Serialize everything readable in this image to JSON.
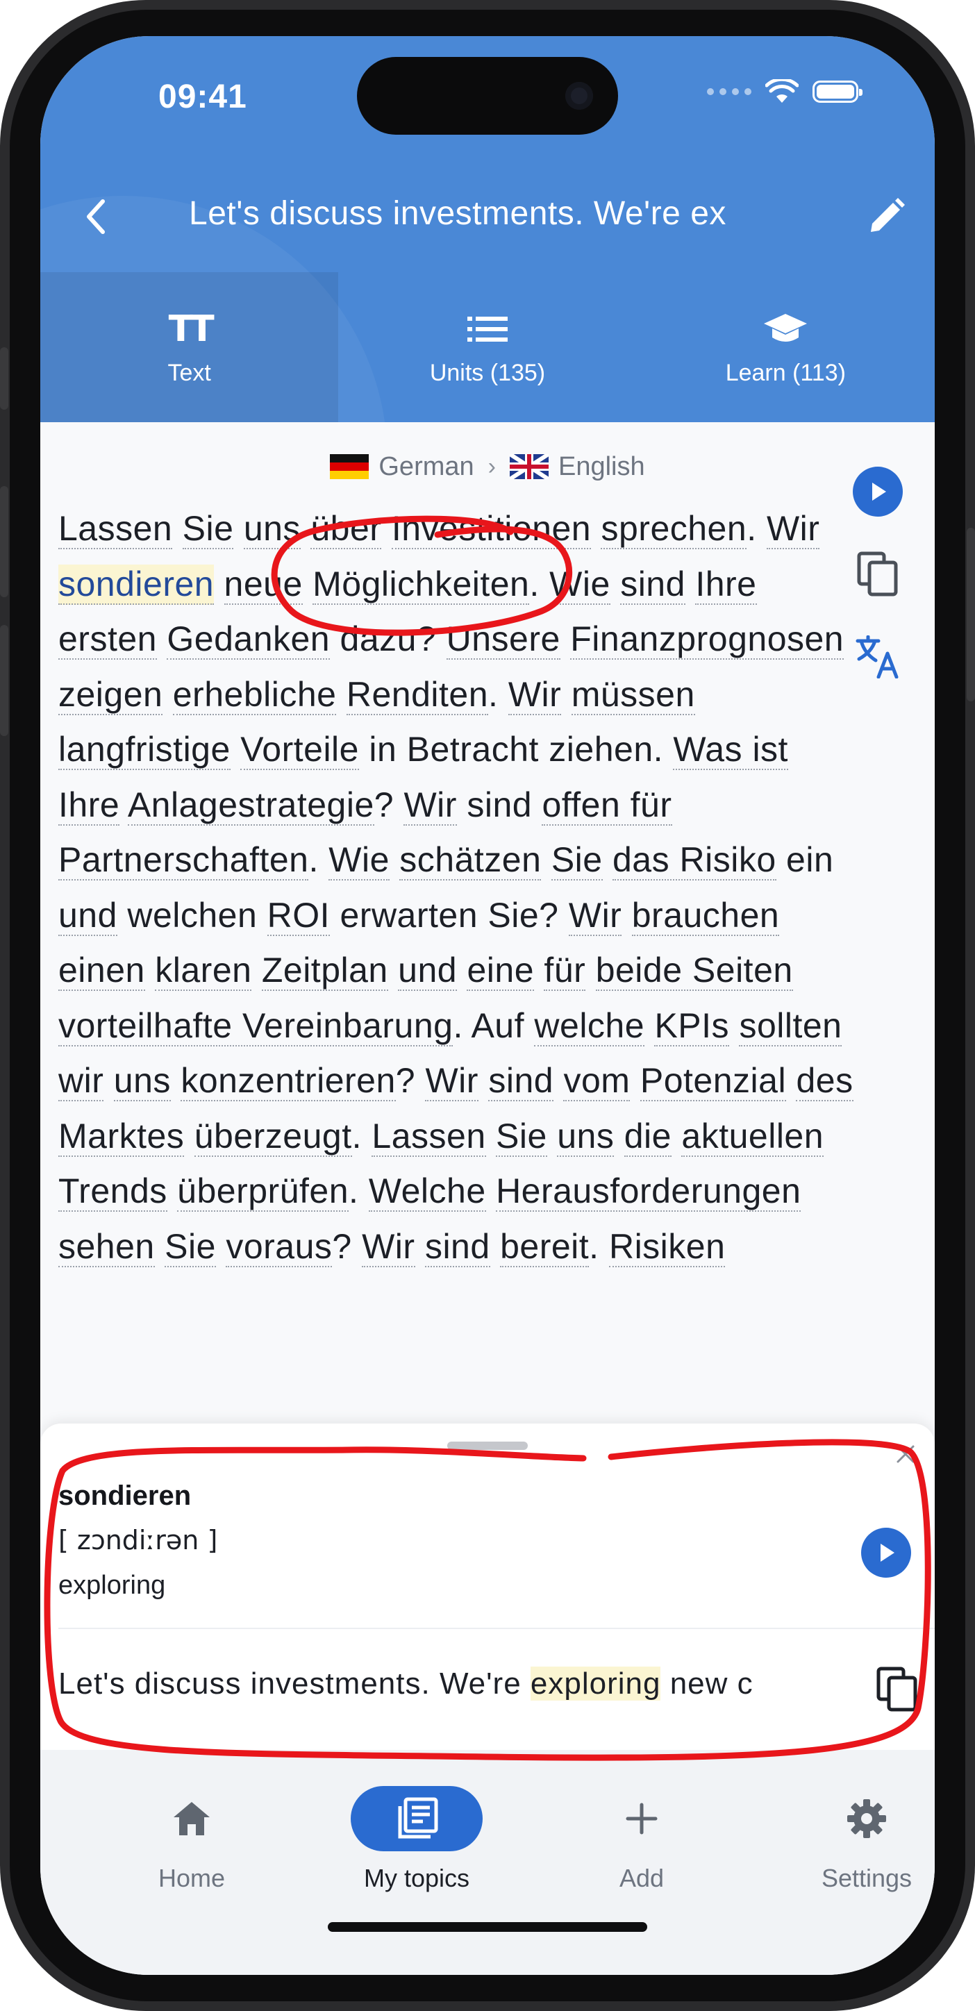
{
  "status_bar": {
    "time": "09:41"
  },
  "header": {
    "title": "Let's discuss investments. We're ex",
    "tabs": [
      {
        "label": "Text",
        "icon": "text-size-icon"
      },
      {
        "label": "Units (135)",
        "icon": "list-icon"
      },
      {
        "label": "Learn (113)",
        "icon": "graduation-cap-icon"
      }
    ]
  },
  "languages": {
    "source": "German",
    "target": "English"
  },
  "text_words": [
    {
      "t": "Lassen",
      "u": 1
    },
    {
      "t": " ",
      "u": 0
    },
    {
      "t": "Sie",
      "u": 1
    },
    {
      "t": " ",
      "u": 0
    },
    {
      "t": "uns",
      "u": 1
    },
    {
      "t": " ",
      "u": 0
    },
    {
      "t": "über",
      "u": 1
    },
    {
      "t": " ",
      "u": 0
    },
    {
      "t": "Investitionen",
      "u": 1
    },
    {
      "t": " ",
      "u": 0
    },
    {
      "t": "sprechen",
      "u": 1
    },
    {
      "t": ". ",
      "u": 0
    },
    {
      "t": "Wir",
      "u": 1
    },
    {
      "t": " ",
      "u": 0
    },
    {
      "t": "sondieren",
      "u": 1,
      "h": 1
    },
    {
      "t": " ",
      "u": 0
    },
    {
      "t": "neue",
      "u": 1
    },
    {
      "t": " ",
      "u": 0
    },
    {
      "t": "Möglichkeiten",
      "u": 1
    },
    {
      "t": ". ",
      "u": 0
    },
    {
      "t": "Wie",
      "u": 1
    },
    {
      "t": " ",
      "u": 0
    },
    {
      "t": "sind",
      "u": 1
    },
    {
      "t": " ",
      "u": 0
    },
    {
      "t": "Ihre",
      "u": 1
    },
    {
      "t": " ",
      "u": 0
    },
    {
      "t": "ersten",
      "u": 1
    },
    {
      "t": " ",
      "u": 0
    },
    {
      "t": "Gedanken",
      "u": 1
    },
    {
      "t": " dazu? ",
      "u": 0
    },
    {
      "t": "Unsere",
      "u": 1
    },
    {
      "t": " ",
      "u": 0
    },
    {
      "t": "Finanzprognosen",
      "u": 1
    },
    {
      "t": " ",
      "u": 0
    },
    {
      "t": "zeigen",
      "u": 1
    },
    {
      "t": " ",
      "u": 0
    },
    {
      "t": "erhebliche",
      "u": 1
    },
    {
      "t": " ",
      "u": 0
    },
    {
      "t": "Renditen",
      "u": 1
    },
    {
      "t": ". ",
      "u": 0
    },
    {
      "t": "Wir",
      "u": 1
    },
    {
      "t": " ",
      "u": 0
    },
    {
      "t": "müssen",
      "u": 1
    },
    {
      "t": " ",
      "u": 0
    },
    {
      "t": "langfristige",
      "u": 1
    },
    {
      "t": " ",
      "u": 0
    },
    {
      "t": "Vorteile",
      "u": 1
    },
    {
      "t": " in Betracht ziehen. ",
      "u": 0
    },
    {
      "t": "Was ist",
      "u": 1
    },
    {
      "t": " ",
      "u": 0
    },
    {
      "t": "Ihre",
      "u": 1
    },
    {
      "t": " ",
      "u": 0
    },
    {
      "t": "Anlagestrategie",
      "u": 1
    },
    {
      "t": "? ",
      "u": 0
    },
    {
      "t": "Wir",
      "u": 1
    },
    {
      "t": " sind ",
      "u": 0
    },
    {
      "t": "offen für",
      "u": 1
    },
    {
      "t": " ",
      "u": 0
    },
    {
      "t": "Partnerschaften",
      "u": 1
    },
    {
      "t": ". ",
      "u": 0
    },
    {
      "t": "Wie",
      "u": 1
    },
    {
      "t": " ",
      "u": 0
    },
    {
      "t": "schätzen",
      "u": 1
    },
    {
      "t": " ",
      "u": 0
    },
    {
      "t": "Sie",
      "u": 1
    },
    {
      "t": " ",
      "u": 0
    },
    {
      "t": "das Risiko",
      "u": 1
    },
    {
      "t": " ein ",
      "u": 0
    },
    {
      "t": "und",
      "u": 1
    },
    {
      "t": " welchen ",
      "u": 0
    },
    {
      "t": "ROI",
      "u": 1
    },
    {
      "t": " ",
      "u": 0
    },
    {
      "t": "erwarten Sie? ",
      "u": 0
    },
    {
      "t": "Wir",
      "u": 1
    },
    {
      "t": " ",
      "u": 0
    },
    {
      "t": "brauchen",
      "u": 1
    },
    {
      "t": " ",
      "u": 0
    },
    {
      "t": "einen",
      "u": 1
    },
    {
      "t": " ",
      "u": 0
    },
    {
      "t": "klaren",
      "u": 1
    },
    {
      "t": " ",
      "u": 0
    },
    {
      "t": "Zeitplan",
      "u": 1
    },
    {
      "t": " ",
      "u": 0
    },
    {
      "t": "und",
      "u": 1
    },
    {
      "t": " ",
      "u": 0
    },
    {
      "t": "eine",
      "u": 1
    },
    {
      "t": " ",
      "u": 0
    },
    {
      "t": "für",
      "u": 1
    },
    {
      "t": " ",
      "u": 0
    },
    {
      "t": "beide Seiten",
      "u": 1
    },
    {
      "t": " ",
      "u": 0
    },
    {
      "t": "vorteilhafte Vereinbarung",
      "u": 1
    },
    {
      "t": ". Auf ",
      "u": 0
    },
    {
      "t": "welche",
      "u": 1
    },
    {
      "t": " ",
      "u": 0
    },
    {
      "t": "KPIs",
      "u": 1
    },
    {
      "t": " ",
      "u": 0
    },
    {
      "t": "sollten",
      "u": 1
    },
    {
      "t": " ",
      "u": 0
    },
    {
      "t": "wir",
      "u": 1
    },
    {
      "t": " ",
      "u": 0
    },
    {
      "t": "uns",
      "u": 1
    },
    {
      "t": " ",
      "u": 0
    },
    {
      "t": "konzentrieren",
      "u": 1
    },
    {
      "t": "? ",
      "u": 0
    },
    {
      "t": "Wir",
      "u": 1
    },
    {
      "t": " ",
      "u": 0
    },
    {
      "t": "sind",
      "u": 1
    },
    {
      "t": " ",
      "u": 0
    },
    {
      "t": "vom",
      "u": 1
    },
    {
      "t": " ",
      "u": 0
    },
    {
      "t": "Potenzial",
      "u": 1
    },
    {
      "t": " ",
      "u": 0
    },
    {
      "t": "des",
      "u": 1
    },
    {
      "t": " ",
      "u": 0
    },
    {
      "t": "Marktes",
      "u": 1
    },
    {
      "t": " ",
      "u": 0
    },
    {
      "t": "überzeugt",
      "u": 1
    },
    {
      "t": ". ",
      "u": 0
    },
    {
      "t": "Lassen",
      "u": 1
    },
    {
      "t": " ",
      "u": 0
    },
    {
      "t": "Sie",
      "u": 1
    },
    {
      "t": " ",
      "u": 0
    },
    {
      "t": "uns",
      "u": 1
    },
    {
      "t": " ",
      "u": 0
    },
    {
      "t": "die",
      "u": 1
    },
    {
      "t": " ",
      "u": 0
    },
    {
      "t": "aktuellen",
      "u": 1
    },
    {
      "t": " ",
      "u": 0
    },
    {
      "t": "Trends",
      "u": 1
    },
    {
      "t": " ",
      "u": 0
    },
    {
      "t": "überprüfen",
      "u": 1
    },
    {
      "t": ". ",
      "u": 0
    },
    {
      "t": "Welche",
      "u": 1
    },
    {
      "t": " ",
      "u": 0
    },
    {
      "t": "Herausforderungen",
      "u": 1
    },
    {
      "t": " ",
      "u": 0
    },
    {
      "t": "sehen",
      "u": 1
    },
    {
      "t": " ",
      "u": 0
    },
    {
      "t": "Sie",
      "u": 1
    },
    {
      "t": " ",
      "u": 0
    },
    {
      "t": "voraus",
      "u": 1
    },
    {
      "t": "? ",
      "u": 0
    },
    {
      "t": "Wir",
      "u": 1
    },
    {
      "t": " ",
      "u": 0
    },
    {
      "t": "sind",
      "u": 1
    },
    {
      "t": " ",
      "u": 0
    },
    {
      "t": "bereit",
      "u": 1
    },
    {
      "t": ". ",
      "u": 0
    },
    {
      "t": "Risiken",
      "u": 1
    }
  ],
  "side_actions": [
    "play-icon",
    "copy-icon",
    "translate-icon"
  ],
  "word_sheet": {
    "word": "sondieren",
    "ipa": "[ zɔndiːrən ]",
    "meaning": "exploring",
    "sentence_before": "Let's discuss investments. We're ",
    "sentence_highlight": "exploring",
    "sentence_after": " new c"
  },
  "bottom_nav": [
    {
      "label": "Home",
      "icon": "home-icon"
    },
    {
      "label": "My topics",
      "icon": "topics-icon",
      "active": true
    },
    {
      "label": "Add",
      "icon": "plus-icon"
    },
    {
      "label": "Settings",
      "icon": "gear-icon"
    }
  ],
  "colors": {
    "header": "#4a88d6",
    "accent": "#2a6bd0",
    "highlight": "#fbf5d2",
    "annotation": "#e8161b"
  }
}
